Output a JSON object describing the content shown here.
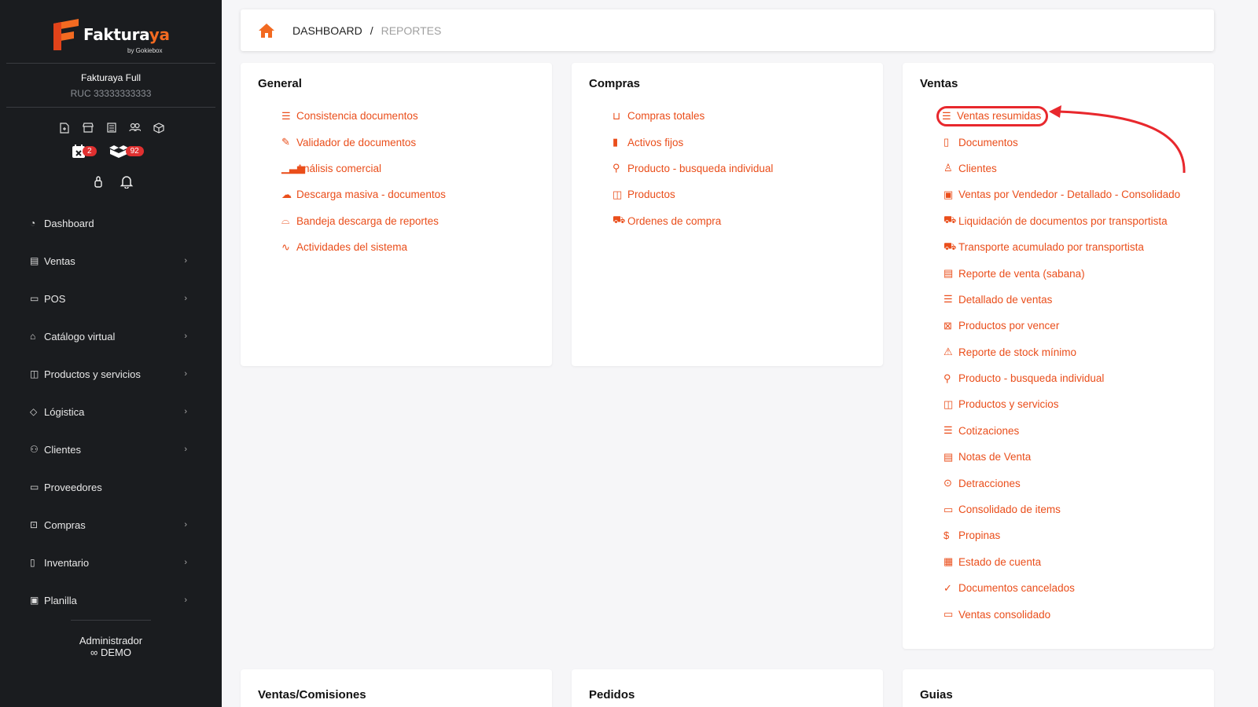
{
  "sidebar": {
    "brand": "Fakturaya",
    "brand_sub": "by Gokiebox",
    "company_name": "Fakturaya Full",
    "ruc": "RUC 33333333333",
    "badges": {
      "calendar_count": "2",
      "boxes_count": "92"
    },
    "nav": [
      {
        "label": "Dashboard",
        "icon": "gauge-icon",
        "chevron": false
      },
      {
        "label": "Ventas",
        "icon": "receipt-icon",
        "chevron": true
      },
      {
        "label": "POS",
        "icon": "monitor-icon",
        "chevron": true
      },
      {
        "label": "Catálogo virtual",
        "icon": "store-icon",
        "chevron": true
      },
      {
        "label": "Productos y servicios",
        "icon": "box-icon",
        "chevron": true
      },
      {
        "label": "Lógistica",
        "icon": "tag-icon",
        "chevron": true
      },
      {
        "label": "Clientes",
        "icon": "users-icon",
        "chevron": true
      },
      {
        "label": "Proveedores",
        "icon": "briefcase-icon",
        "chevron": false
      },
      {
        "label": "Compras",
        "icon": "bag-icon",
        "chevron": true
      },
      {
        "label": "Inventario",
        "icon": "book-icon",
        "chevron": true
      },
      {
        "label": "Planilla",
        "icon": "id-badge-icon",
        "chevron": true
      }
    ],
    "user_role": "Administrador",
    "user_name": "DEMO"
  },
  "breadcrumb": {
    "home": "home-icon",
    "level1": "DASHBOARD",
    "separator": "/",
    "level2": "REPORTES"
  },
  "sections": {
    "general": {
      "title": "General",
      "items": [
        {
          "label": "Consistencia documentos",
          "icon": "card-list-icon"
        },
        {
          "label": "Validador de documentos",
          "icon": "clipboard-check-icon"
        },
        {
          "label": "Análisis comercial",
          "icon": "bar-chart-icon"
        },
        {
          "label": "Descarga masiva - documentos",
          "icon": "cloud-download-icon"
        },
        {
          "label": "Bandeja descarga de reportes",
          "icon": "inbox-icon"
        },
        {
          "label": "Actividades del sistema",
          "icon": "activity-icon"
        }
      ]
    },
    "compras": {
      "title": "Compras",
      "items": [
        {
          "label": "Compras totales",
          "icon": "basket-icon"
        },
        {
          "label": "Activos fijos",
          "icon": "bookmark-icon"
        },
        {
          "label": "Producto - busqueda individual",
          "icon": "search-icon"
        },
        {
          "label": "Productos",
          "icon": "box-icon"
        },
        {
          "label": "Ordenes de compra",
          "icon": "cart-icon"
        }
      ]
    },
    "ventas": {
      "title": "Ventas",
      "items": [
        {
          "label": "Ventas resumidas",
          "icon": "list-icon"
        },
        {
          "label": "Documentos",
          "icon": "file-icon"
        },
        {
          "label": "Clientes",
          "icon": "person-icon"
        },
        {
          "label": "Ventas por Vendedor - Detallado - Consolidado",
          "icon": "person-square-icon"
        },
        {
          "label": "Liquidación de documentos por transportista",
          "icon": "truck-icon"
        },
        {
          "label": "Transporte acumulado por transportista",
          "icon": "truck-icon"
        },
        {
          "label": "Reporte de venta (sabana)",
          "icon": "file-text-icon"
        },
        {
          "label": "Detallado de ventas",
          "icon": "list-icon"
        },
        {
          "label": "Productos por vencer",
          "icon": "calendar-x-icon"
        },
        {
          "label": "Reporte de stock mínimo",
          "icon": "warning-icon"
        },
        {
          "label": "Producto - busqueda individual",
          "icon": "search-icon"
        },
        {
          "label": "Productos y servicios",
          "icon": "box-icon"
        },
        {
          "label": "Cotizaciones",
          "icon": "list-icon"
        },
        {
          "label": "Notas de Venta",
          "icon": "card-text-icon"
        },
        {
          "label": "Detracciones",
          "icon": "cash-icon"
        },
        {
          "label": "Consolidado de items",
          "icon": "collection-icon"
        },
        {
          "label": "Propinas",
          "icon": "dollar-icon"
        },
        {
          "label": "Estado de cuenta",
          "icon": "file-chart-icon"
        },
        {
          "label": "Documentos cancelados",
          "icon": "check-circle-icon"
        },
        {
          "label": "Ventas consolidado",
          "icon": "collection-icon"
        }
      ]
    }
  },
  "bottom_sections": [
    "Ventas/Comisiones",
    "Pedidos",
    "Guias"
  ],
  "colors": {
    "accent": "#ea4e1b",
    "sidebar_bg": "#1a1c1f",
    "highlight": "#e8282d",
    "badge": "#e03030"
  }
}
